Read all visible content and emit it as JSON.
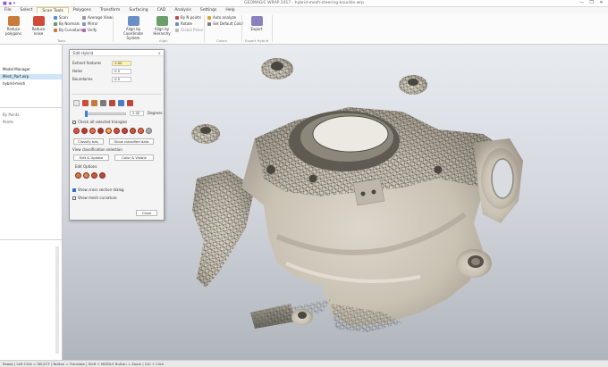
{
  "window": {
    "title": "GEOMAGIC WRAP 2017 - hybrid-mesh-steering-knuckle.wrp",
    "quick_access": "■ ◆ ▾",
    "controls": [
      "—",
      "❐",
      "✕"
    ]
  },
  "tabs": [
    "File",
    "Select",
    "Scan Tools",
    "Polygons",
    "Transform",
    "Surfacing",
    "CAD",
    "Analysis",
    "Settings",
    "Help"
  ],
  "ribbon": {
    "buttons": [
      {
        "label": "Reduce polygons",
        "color": "#c97b3a"
      },
      {
        "label": "Reduce noise",
        "color": "#d04a3a"
      },
      {
        "label": "Align by Coordinate System",
        "color": "#6a8fc7"
      },
      {
        "label": "Align by Hierarchy",
        "color": "#6a9f6a"
      },
      {
        "label": "Export",
        "color": "#8a7fbf"
      }
    ],
    "small": [
      "Scan",
      "By Normals",
      "By Curvature",
      "Average Views",
      "Mirror",
      "Unify",
      "By N points",
      "Rotate",
      "Global Plane",
      "Auto analyze",
      "Set Default Color"
    ],
    "groups": [
      "Tools",
      "Align",
      "Colors",
      "Export Hybrid"
    ]
  },
  "left_panel": {
    "items": [
      "Model Manager",
      "Mesh_Part.wrp",
      "hybrid-mesh",
      "By Points",
      "Points"
    ],
    "selected_index": 1
  },
  "dialog": {
    "title": "Edit Hybrid",
    "close": "✕",
    "fields": [
      {
        "label": "Extract features",
        "value": "1.00"
      },
      {
        "label": "Holes",
        "value": "0.5"
      },
      {
        "label": "Boundaries",
        "value": "0.5"
      }
    ],
    "slider": {
      "value": "2.00",
      "unit": "Degrees",
      "level": 0.2
    },
    "check_all": "Check all selected triangles",
    "buttons": [
      "Classify bas.",
      "Show classified data"
    ],
    "section_label": "View classification selection",
    "buttons2": [
      "Edit & Update",
      "Color & Visible"
    ],
    "options_label": "Edit Options",
    "checks": [
      {
        "label": "Show cross section dialog",
        "checked": true
      },
      {
        "label": "Show mesh curvature",
        "checked": false
      }
    ],
    "close_btn": "Close"
  },
  "status": "Ready  |  Left Click = SELECT  |  Button = Translate  |  Shift + MIDDLE Button = Zoom  |  Ctrl + Click"
}
